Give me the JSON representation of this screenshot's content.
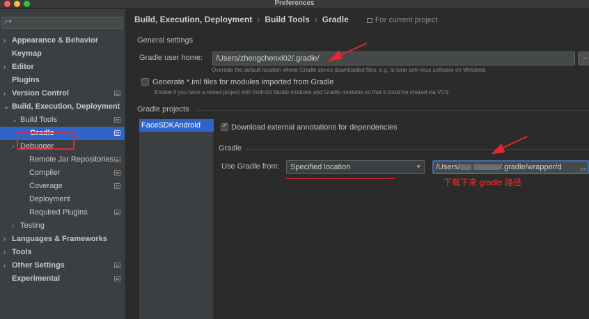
{
  "window": {
    "title": "Preferences"
  },
  "search": {
    "icon": "search-icon",
    "placeholder": ""
  },
  "sidebar": {
    "items": [
      {
        "label": "Appearance & Behavior",
        "arrow": "›",
        "bold": true,
        "project": false
      },
      {
        "label": "Keymap",
        "arrow": "",
        "bold": true,
        "project": false
      },
      {
        "label": "Editor",
        "arrow": "›",
        "bold": true,
        "project": false
      },
      {
        "label": "Plugins",
        "arrow": "",
        "bold": true,
        "project": false
      },
      {
        "label": "Version Control",
        "arrow": "›",
        "bold": true,
        "project": true
      },
      {
        "label": "Build, Execution, Deployment",
        "arrow": "⌄",
        "bold": true,
        "project": false
      },
      {
        "label": "Build Tools",
        "arrow": "⌄",
        "bold": false,
        "project": true
      },
      {
        "label": "Gradle",
        "arrow": "",
        "bold": true,
        "project": true,
        "selected": true
      },
      {
        "label": "Debugger",
        "arrow": "›",
        "bold": false,
        "project": false
      },
      {
        "label": "Remote Jar Repositories",
        "arrow": "",
        "bold": false,
        "project": true
      },
      {
        "label": "Compiler",
        "arrow": "",
        "bold": false,
        "project": true
      },
      {
        "label": "Coverage",
        "arrow": "",
        "bold": false,
        "project": true
      },
      {
        "label": "Deployment",
        "arrow": "",
        "bold": false,
        "project": false
      },
      {
        "label": "Required Plugins",
        "arrow": "",
        "bold": false,
        "project": true
      },
      {
        "label": "Testing",
        "arrow": "›",
        "bold": false,
        "project": false
      },
      {
        "label": "Languages & Frameworks",
        "arrow": "›",
        "bold": true,
        "project": false
      },
      {
        "label": "Tools",
        "arrow": "›",
        "bold": true,
        "project": false
      },
      {
        "label": "Other Settings",
        "arrow": "›",
        "bold": true,
        "project": true
      },
      {
        "label": "Experimental",
        "arrow": "",
        "bold": true,
        "project": true
      }
    ]
  },
  "breadcrumb": {
    "items": [
      "Build, Execution, Deployment",
      "Build Tools",
      "Gradle"
    ],
    "separator": "›",
    "scope": "For current project"
  },
  "general": {
    "title": "General settings",
    "user_home_label": "Gradle user home:",
    "user_home_value": "/Users/zhengchenxi02/.gradle/",
    "browse_label": "...",
    "user_home_hint": "Override the default location where Gradle stores downloaded files, e.g. to tune anti-virus software on Windows",
    "iml_label": "Generate *.iml files for modules imported from Gradle",
    "iml_checked": false,
    "iml_hint": "Enable if you have a mixed project with Android Studio modules and Gradle modules so that it could be shared via VCS"
  },
  "projects": {
    "title": "Gradle projects",
    "list": [
      "FaceSDKAndroid"
    ],
    "annotations_label": "Download external annotations for dependencies",
    "annotations_checked": true,
    "gradle_section_title": "Gradle",
    "use_gradle_from_label": "Use Gradle from:",
    "use_gradle_from_value": "Specified location",
    "path_prefix": "/Users/",
    "path_suffix": "/.gradle/wrapper/d",
    "annotation_note": "下载下来 gradle 路径"
  },
  "colors": {
    "accent": "#2f65ca",
    "annotation_red": "#e8262b"
  }
}
